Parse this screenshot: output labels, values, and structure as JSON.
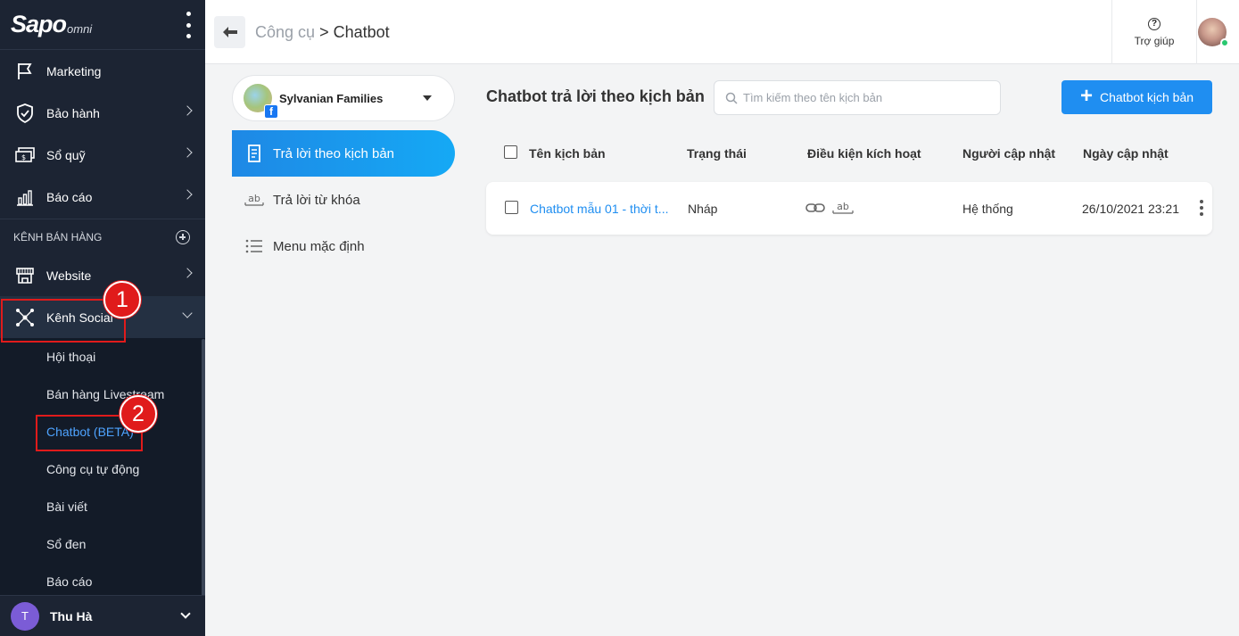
{
  "sidebar": {
    "logo_main": "Sapo",
    "logo_sub": "omni",
    "items": [
      {
        "label": "Marketing"
      },
      {
        "label": "Bảo hành"
      },
      {
        "label": "Sổ quỹ"
      },
      {
        "label": "Báo cáo"
      }
    ],
    "section_label": "KÊNH BÁN HÀNG",
    "channel_items": [
      {
        "label": "Website"
      },
      {
        "label": "Kênh Social"
      }
    ],
    "sub_items": [
      {
        "label": "Hội thoại"
      },
      {
        "label": "Bán hàng Livestream"
      },
      {
        "label": "Chatbot (BETA)"
      },
      {
        "label": "Công cụ tự động"
      },
      {
        "label": "Bài viết"
      },
      {
        "label": "Sổ đen"
      },
      {
        "label": "Báo cáo"
      }
    ],
    "user": {
      "initial": "T",
      "name": "Thu Hà"
    }
  },
  "annotations": {
    "step1": "1",
    "step2": "2"
  },
  "header": {
    "breadcrumb_parent": "Công cụ",
    "breadcrumb_sep": ">",
    "breadcrumb_current": "Chatbot",
    "help_label": "Trợ giúp"
  },
  "channel": {
    "name": "Sylvanian Families",
    "nav": [
      {
        "label": "Trả lời theo kịch bản"
      },
      {
        "label": "Trả lời từ khóa"
      },
      {
        "label": "Menu mặc định"
      }
    ]
  },
  "main": {
    "title": "Chatbot trả lời theo kịch bản",
    "search_placeholder": "Tìm kiếm theo tên kịch bản",
    "add_button": "Chatbot kịch bản",
    "columns": [
      "Tên kịch bản",
      "Trạng thái",
      "Điều kiện kích hoạt",
      "Người cập nhật",
      "Ngày cập nhật"
    ],
    "rows": [
      {
        "name": "Chatbot mẫu 01 - thời t...",
        "status": "Nháp",
        "updated_by": "Hệ thống",
        "updated_at": "26/10/2021 23:21"
      }
    ]
  },
  "colors": {
    "sidebar_bg": "#1c2433",
    "accent": "#1f8ef1",
    "annotation": "#e01b1b"
  }
}
